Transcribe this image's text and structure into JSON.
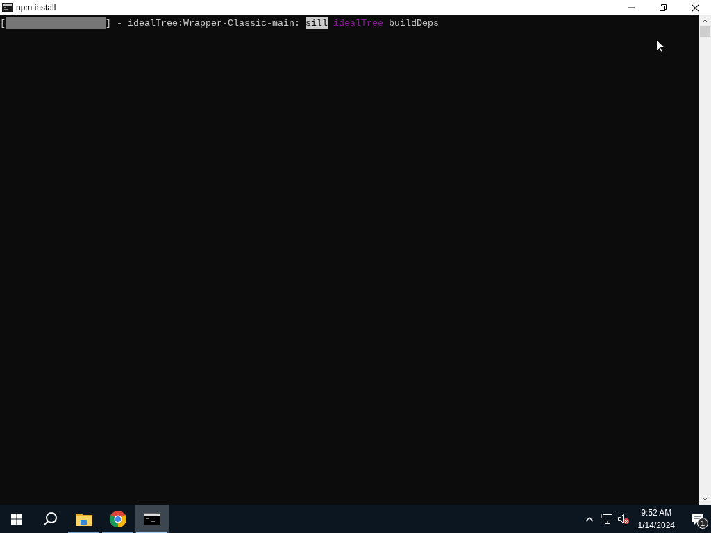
{
  "window": {
    "title": "npm install"
  },
  "terminal": {
    "lines": [
      [
        {
          "kind": "text",
          "text": "["
        },
        {
          "kind": "gauge"
        },
        {
          "kind": "text",
          "text": "] - idealTree:Wrapper-Classic-main: "
        },
        {
          "kind": "highlight",
          "text": "sill"
        },
        {
          "kind": "magenta",
          "text": " idealTree"
        },
        {
          "kind": "text",
          "text": " buildDeps"
        }
      ]
    ]
  },
  "taskbar": {
    "apps": [
      {
        "kind": "folder",
        "running": true,
        "selected": false
      },
      {
        "kind": "browser",
        "running": true,
        "selected": false
      },
      {
        "kind": "console",
        "running": true,
        "selected": true
      }
    ],
    "time": "9:52 AM",
    "date": "1/14/2024",
    "notifications": "1"
  }
}
